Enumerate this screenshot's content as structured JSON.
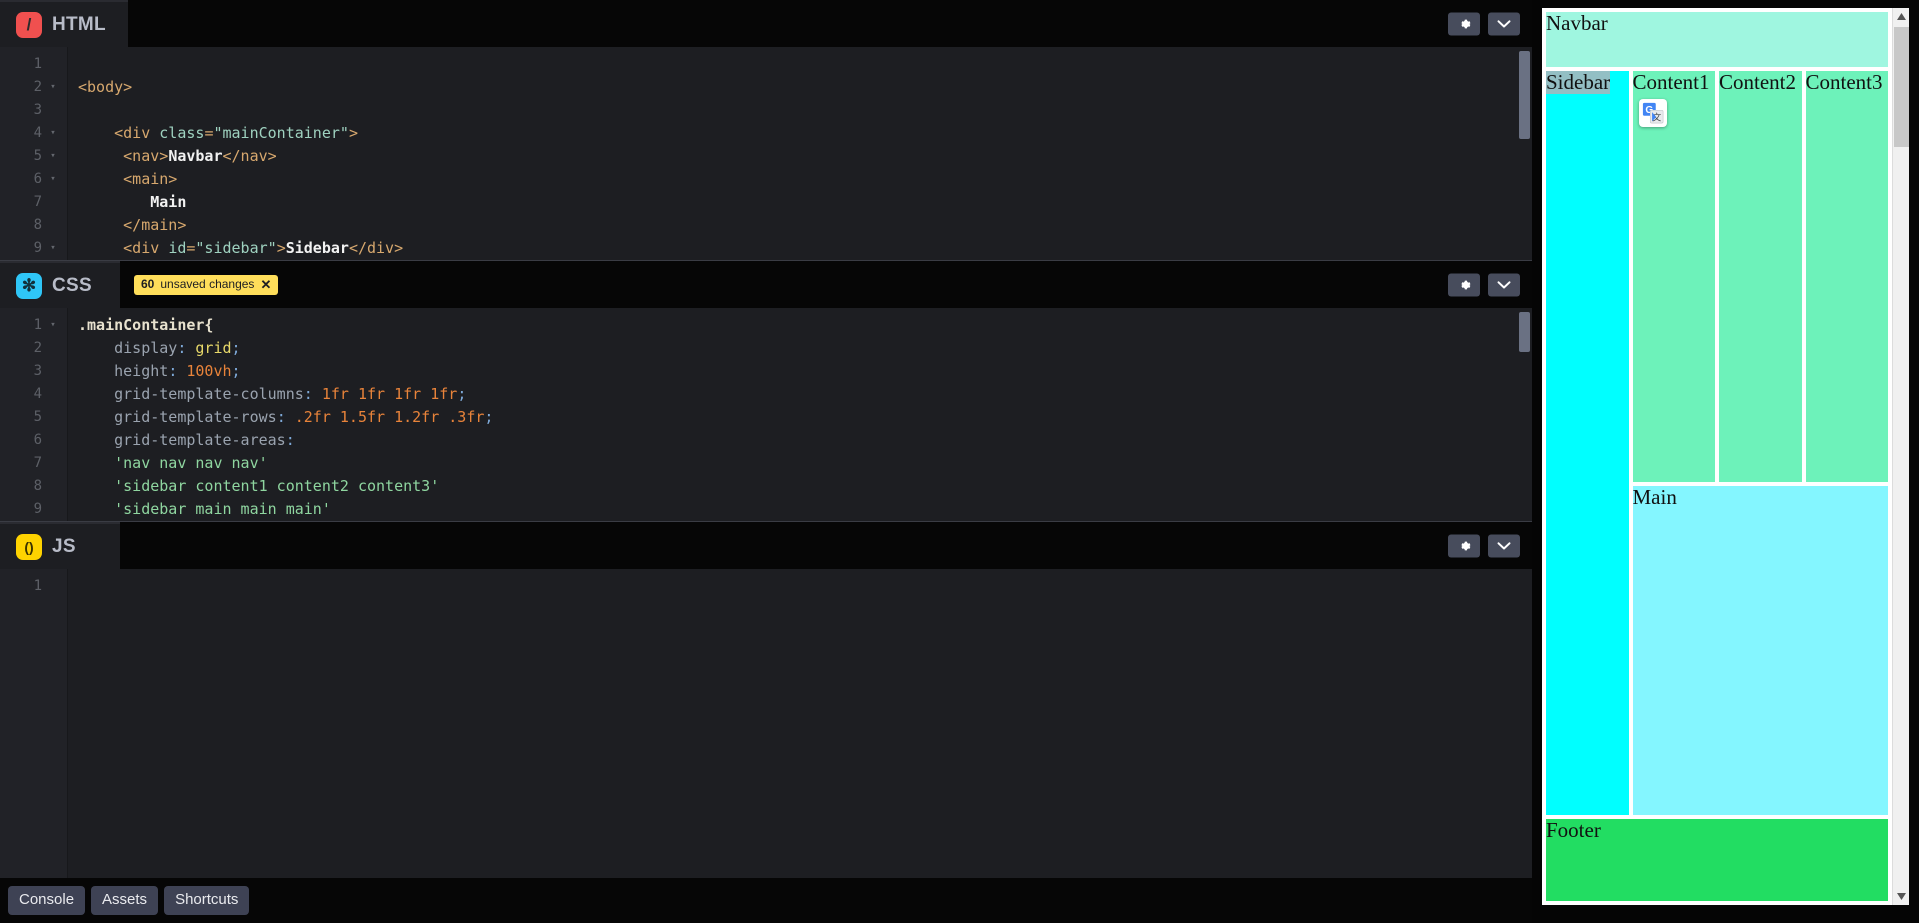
{
  "app": {
    "name": "code-editor-playground"
  },
  "panes": [
    {
      "id": "html",
      "lang_label": "HTML",
      "badge_glyph": "/",
      "unsaved": null,
      "gear_name": "settings-gear",
      "chevron_name": "collapse-chevron",
      "lines": [
        {
          "n": "1",
          "fold": "",
          "tokens": []
        },
        {
          "n": "2",
          "fold": "▾",
          "tokens": [
            {
              "c": "t-tag",
              "s": "<body>"
            }
          ]
        },
        {
          "n": "3",
          "fold": "",
          "tokens": []
        },
        {
          "n": "4",
          "fold": "▾",
          "tokens": [
            {
              "c": "t-tag",
              "s": "    <div "
            },
            {
              "c": "t-attr",
              "s": "class"
            },
            {
              "c": "t-tag",
              "s": "="
            },
            {
              "c": "t-str",
              "s": "\"mainContainer\""
            },
            {
              "c": "t-tag",
              "s": ">"
            }
          ]
        },
        {
          "n": "5",
          "fold": "▾",
          "tokens": [
            {
              "c": "t-tag",
              "s": "     <nav>"
            },
            {
              "c": "t-text",
              "s": "Navbar"
            },
            {
              "c": "t-tag",
              "s": "</nav>"
            }
          ]
        },
        {
          "n": "6",
          "fold": "▾",
          "tokens": [
            {
              "c": "t-tag",
              "s": "     <main>"
            }
          ]
        },
        {
          "n": "7",
          "fold": "",
          "tokens": [
            {
              "c": "t-text",
              "s": "        Main"
            }
          ]
        },
        {
          "n": "8",
          "fold": "",
          "tokens": [
            {
              "c": "t-tag",
              "s": "     </main>"
            }
          ]
        },
        {
          "n": "9",
          "fold": "▾",
          "tokens": [
            {
              "c": "t-tag",
              "s": "     <div "
            },
            {
              "c": "t-attr",
              "s": "id"
            },
            {
              "c": "t-tag",
              "s": "="
            },
            {
              "c": "t-str",
              "s": "\"sidebar\""
            },
            {
              "c": "t-tag",
              "s": ">"
            },
            {
              "c": "t-text",
              "s": "Sidebar"
            },
            {
              "c": "t-tag",
              "s": "</div>"
            }
          ]
        }
      ]
    },
    {
      "id": "css",
      "lang_label": "CSS",
      "badge_glyph": "✻",
      "unsaved": {
        "count": "60",
        "label": "unsaved changes",
        "dismiss": "✕"
      },
      "gear_name": "settings-gear",
      "chevron_name": "collapse-chevron",
      "lines": [
        {
          "n": "1",
          "fold": "▾",
          "tokens": [
            {
              "c": "t-sel",
              "s": ".mainContainer{"
            }
          ]
        },
        {
          "n": "2",
          "fold": "",
          "tokens": [
            {
              "c": "t-prop",
              "s": "    display"
            },
            {
              "c": "t-punct",
              "s": ":"
            },
            {
              "c": "t-kw",
              "s": " grid"
            },
            {
              "c": "t-punct",
              "s": ";"
            }
          ]
        },
        {
          "n": "3",
          "fold": "",
          "tokens": [
            {
              "c": "t-prop",
              "s": "    height"
            },
            {
              "c": "t-punct",
              "s": ":"
            },
            {
              "c": "t-num",
              "s": " 100vh"
            },
            {
              "c": "t-punct",
              "s": ";"
            }
          ]
        },
        {
          "n": "4",
          "fold": "",
          "tokens": [
            {
              "c": "t-prop",
              "s": "    grid-template-columns"
            },
            {
              "c": "t-punct",
              "s": ":"
            },
            {
              "c": "t-num",
              "s": " 1fr 1fr 1fr 1fr"
            },
            {
              "c": "t-punct",
              "s": ";"
            }
          ]
        },
        {
          "n": "5",
          "fold": "",
          "tokens": [
            {
              "c": "t-prop",
              "s": "    grid-template-rows"
            },
            {
              "c": "t-punct",
              "s": ":"
            },
            {
              "c": "t-num",
              "s": " .2fr 1.5fr 1.2fr .3fr"
            },
            {
              "c": "t-punct",
              "s": ";"
            }
          ]
        },
        {
          "n": "6",
          "fold": "",
          "tokens": [
            {
              "c": "t-prop",
              "s": "    grid-template-areas"
            },
            {
              "c": "t-punct",
              "s": ":"
            }
          ]
        },
        {
          "n": "7",
          "fold": "",
          "tokens": [
            {
              "c": "t-cssstr",
              "s": "    'nav nav nav nav'"
            }
          ]
        },
        {
          "n": "8",
          "fold": "",
          "tokens": [
            {
              "c": "t-cssstr",
              "s": "    'sidebar content1 content2 content3'"
            }
          ]
        },
        {
          "n": "9",
          "fold": "",
          "tokens": [
            {
              "c": "t-cssstr",
              "s": "    'sidebar main main main'"
            }
          ]
        }
      ]
    },
    {
      "id": "js",
      "lang_label": "JS",
      "badge_glyph": "()",
      "unsaved": null,
      "gear_name": "settings-gear",
      "chevron_name": "collapse-chevron",
      "lines": [
        {
          "n": "1",
          "fold": "",
          "tokens": []
        }
      ]
    }
  ],
  "bottom_bar": {
    "buttons": [
      {
        "label": "Console"
      },
      {
        "label": "Assets"
      },
      {
        "label": "Shortcuts"
      }
    ]
  },
  "preview": {
    "regions": {
      "nav": "Navbar",
      "sidebar": "Sidebar",
      "content1": "Content1",
      "content2": "Content2",
      "content3": "Content3",
      "main": "Main",
      "footer": "Footer"
    },
    "overlay_icon": "google-translate-icon",
    "colors": {
      "nav": "#9ff6e0",
      "sidebar": "#00ffff",
      "content": "#6df2ba",
      "main": "#84f6ff",
      "footer": "#22dd62"
    },
    "scrollbar": {
      "up_arrow": "▲",
      "down_arrow": "▼"
    }
  }
}
